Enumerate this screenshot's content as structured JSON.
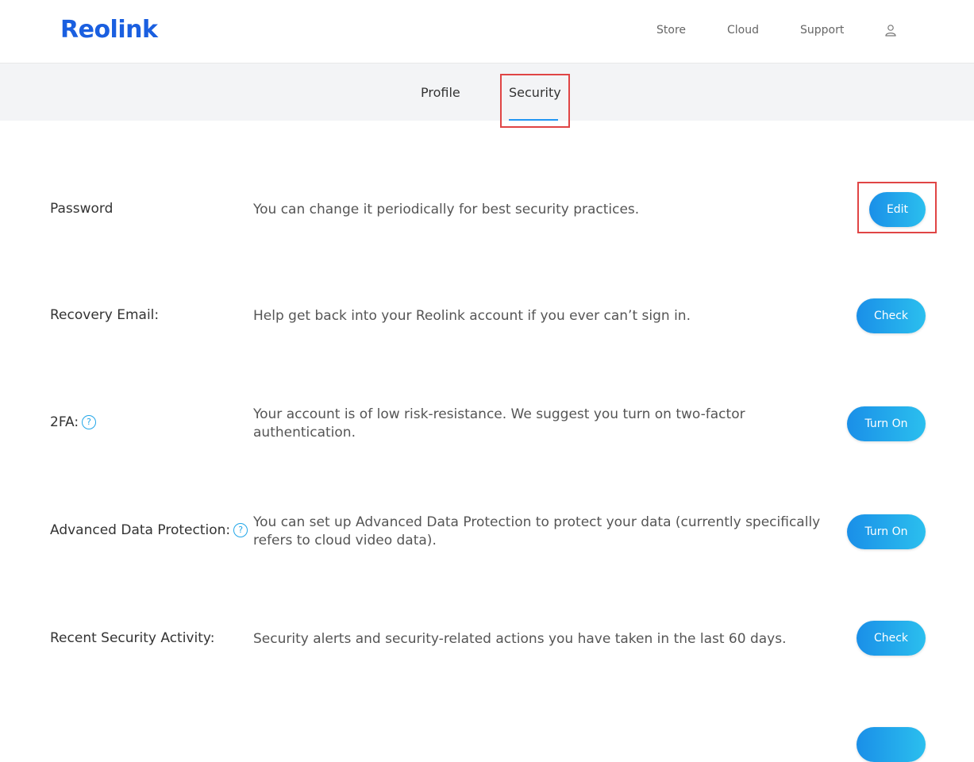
{
  "header": {
    "logo_text": "Reolink",
    "nav": {
      "store": "Store",
      "cloud": "Cloud",
      "support": "Support"
    },
    "user_icon": "user-icon"
  },
  "tabs": {
    "profile": "Profile",
    "security": "Security",
    "active": "Security"
  },
  "rows": [
    {
      "label": "Password",
      "description": "You can change it periodically for best security practices.",
      "button": "Edit",
      "help": false
    },
    {
      "label": "Recovery Email:",
      "description": "Help get back into your Reolink account if you ever can’t sign in.",
      "button": "Check",
      "help": false
    },
    {
      "label": "2FA:",
      "description": "Your account is of low risk-resistance. We suggest you turn on two-factor authentication.",
      "button": "Turn On",
      "help": true
    },
    {
      "label": "Advanced Data Protection:",
      "description": "You can set up Advanced Data Protection to protect your data (currently specifically refers to cloud video data).",
      "button": "Turn On",
      "help": true
    },
    {
      "label": "Recent Security Activity:",
      "description": "Security alerts and security-related actions you have taken in the last 60 days.",
      "button": "Check",
      "help": false
    }
  ],
  "help_icon_glyph": "?",
  "colors": {
    "brand": "#1a5fe0",
    "accent": "#22a6e8",
    "button_gradient_start": "#1a8fe8",
    "button_gradient_end": "#2bbfee",
    "highlight": "#e04545",
    "tabbar_bg": "#f3f4f6"
  }
}
